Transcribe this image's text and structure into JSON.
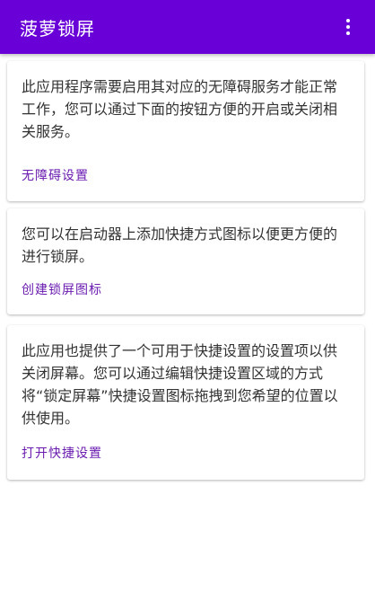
{
  "app_bar": {
    "title": "菠萝锁屏",
    "overflow_icon": "more-vert-icon"
  },
  "cards": [
    {
      "text": "此应用程序需要启用其对应的无障碍服务才能正常工作，您可以通过下面的按钮方便的开启或关闭相关服务。",
      "action": "无障碍设置"
    },
    {
      "text": "您可以在启动器上添加快捷方式图标以便更方便的进行锁屏。",
      "action": "创建锁屏图标"
    },
    {
      "text": "此应用也提供了一个可用于快捷设置的设置项以供关闭屏幕。您可以通过编辑快捷设置区域的方式将“锁定屏幕”快捷设置图标拖拽到您希望的位置以供使用。",
      "action": "打开快捷设置"
    }
  ],
  "colors": {
    "primary": "#6a00d8",
    "accent_text": "#6a1bb0",
    "body_text": "#333333"
  }
}
